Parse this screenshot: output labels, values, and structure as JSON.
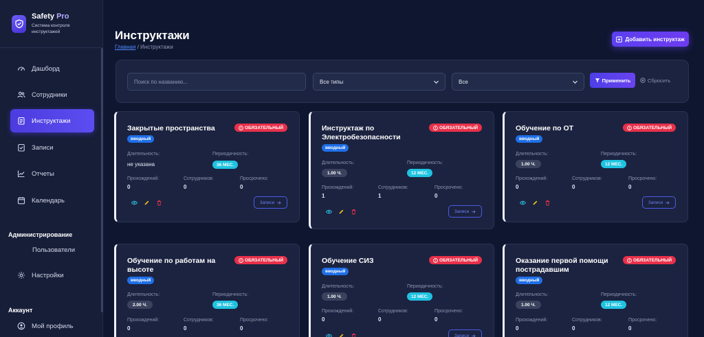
{
  "brand": {
    "name_a": "Safety",
    "name_b": "Pro",
    "subtitle": "Система контроля инструктажей"
  },
  "nav": {
    "items": [
      {
        "label": "Дашборд",
        "icon": "gauge-icon"
      },
      {
        "label": "Сотрудники",
        "icon": "users-icon"
      },
      {
        "label": "Инструктажи",
        "icon": "clipboard-icon"
      },
      {
        "label": "Записи",
        "icon": "checklist-icon"
      },
      {
        "label": "Отчеты",
        "icon": "chart-line-icon"
      },
      {
        "label": "Календарь",
        "icon": "calendar-icon"
      }
    ],
    "admin_title": "Администрирование",
    "admin_users": "Пользователи",
    "settings": "Настройки",
    "account_title": "Аккаунт",
    "profile": "Мой профиль"
  },
  "header": {
    "title": "Инструктажи",
    "crumb_home": "Главная",
    "crumb_sep": "/",
    "crumb_current": "Инструктажи",
    "add_label": "Добавить инструктаж"
  },
  "filters": {
    "search_placeholder": "Поиск по названию...",
    "type_value": "Все типы",
    "status_value": "Все",
    "apply_label": "Применить",
    "reset_label": "Сбросить"
  },
  "labels": {
    "duration": "Длительность:",
    "periodicity": "Периодичность:",
    "passed": "Прохождений:",
    "employees": "Сотрудников:",
    "overdue": "Просрочено:",
    "records": "Записи"
  },
  "cards": [
    {
      "title": "Закрытые пространства",
      "required": "ОБЯЗАТЕЛЬНЫЙ",
      "type": "вводный",
      "duration": "не указана",
      "period": "36 МЕС.",
      "passed": "0",
      "employees": "0",
      "overdue": "0"
    },
    {
      "title": "Инструктаж по Электробезопасности",
      "required": "ОБЯЗАТЕЛЬНЫЙ",
      "type": "вводный",
      "duration": "1.00 Ч.",
      "period": "12 МЕС.",
      "passed": "1",
      "employees": "1",
      "overdue": "0"
    },
    {
      "title": "Обучение по ОТ",
      "required": "ОБЯЗАТЕЛЬНЫЙ",
      "type": "вводный",
      "duration": "1.00 Ч.",
      "period": "12 МЕС.",
      "passed": "0",
      "employees": "0",
      "overdue": "0"
    },
    {
      "title": "Обучение по работам на высоте",
      "required": "ОБЯЗАТЕЛЬНЫЙ",
      "type": "вводный",
      "duration": "2.00 Ч.",
      "period": "36 МЕС.",
      "passed": "0",
      "employees": "0",
      "overdue": "0"
    },
    {
      "title": "Обучение СИЗ",
      "required": "ОБЯЗАТЕЛЬНЫЙ",
      "type": "вводный",
      "duration": "1.00 Ч.",
      "period": "12 МЕС.",
      "passed": "0",
      "employees": "0",
      "overdue": "0"
    },
    {
      "title": "Оказание первой помощи пострадавшим",
      "required": "ОБЯЗАТЕЛЬНЫЙ",
      "type": "вводный",
      "duration": "1.00 Ч.",
      "period": "12 МЕС.",
      "passed": "0",
      "employees": "0",
      "overdue": "0"
    }
  ]
}
